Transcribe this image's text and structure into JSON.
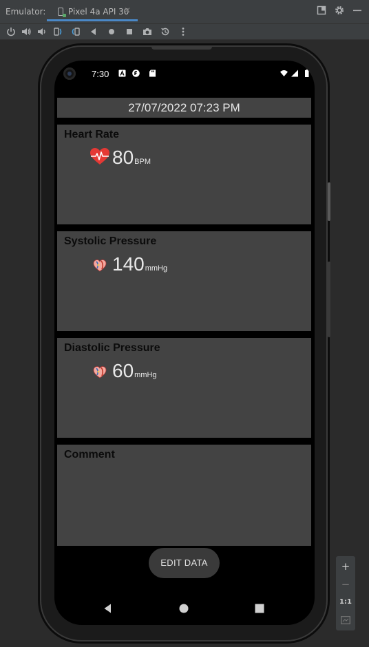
{
  "emulator": {
    "label": "Emulator:",
    "tab_title": "Pixel 4a API 30",
    "tab_close": "✕"
  },
  "zoom": {
    "zoom_in": "+",
    "zoom_out": "−",
    "actual_size": "1:1"
  },
  "status": {
    "time": "7:30"
  },
  "app": {
    "datetime": "27/07/2022  07:23 PM",
    "cards": [
      {
        "title": "Heart Rate",
        "value": "80",
        "unit": "BPM"
      },
      {
        "title": "Systolic Pressure",
        "value": "140",
        "unit": "mmHg"
      },
      {
        "title": "Diastolic Pressure",
        "value": "60",
        "unit": "mmHg"
      },
      {
        "title": "Comment"
      }
    ],
    "edit_button": "EDIT DATA"
  },
  "colors": {
    "card_bg": "#434343",
    "heart": "#e53935",
    "tab_underline": "#4a88c7"
  }
}
